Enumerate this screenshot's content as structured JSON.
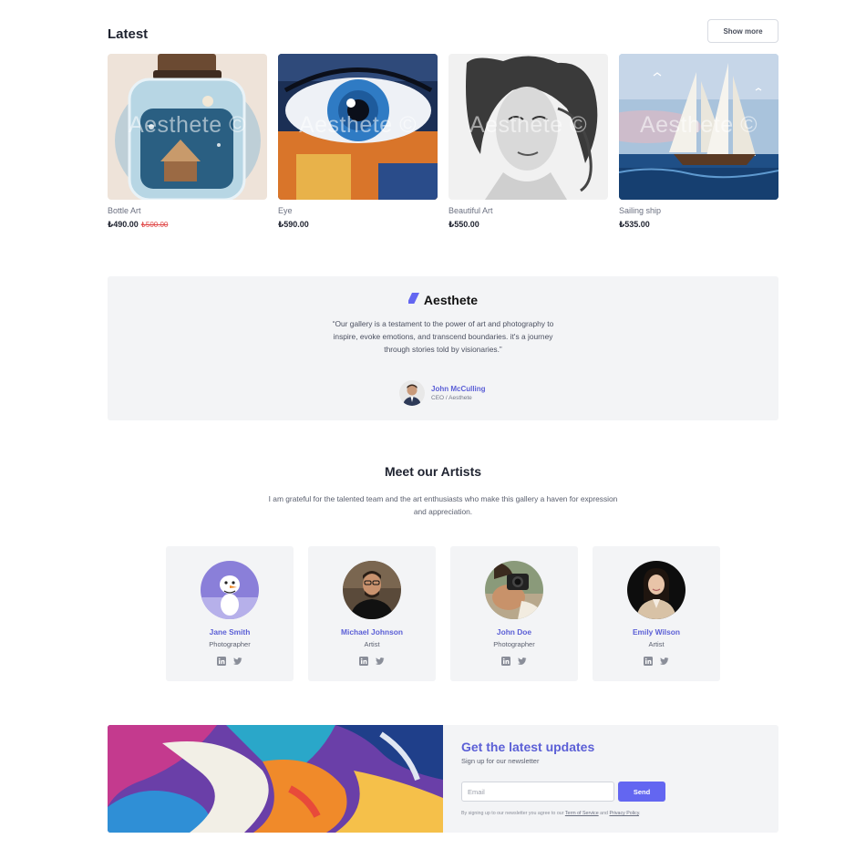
{
  "latest": {
    "heading": "Latest",
    "show_more": "Show more",
    "watermark": "Aesthete ©",
    "products": [
      {
        "name": "Bottle Art",
        "price": "₺490.00",
        "old_price": "₺500.00"
      },
      {
        "name": "Eye",
        "price": "₺590.00"
      },
      {
        "name": "Beautiful Art",
        "price": "₺550.00"
      },
      {
        "name": "Sailing ship",
        "price": "₺535.00"
      }
    ]
  },
  "testimonial": {
    "brand": "Aesthete",
    "quote": "“Our gallery is a testament to the power of art and photography to inspire, evoke emotions, and transcend boundaries. it's a journey through stories told by visionaries.”",
    "author_name": "John McCulling",
    "author_role": "CEO / Aesthete"
  },
  "artists": {
    "heading": "Meet our Artists",
    "subtitle": "I am grateful for the talented team and the art enthusiasts who make this gallery a haven for expression and appreciation.",
    "members": [
      {
        "name": "Jane Smith",
        "role": "Photographer"
      },
      {
        "name": "Michael Johnson",
        "role": "Artist"
      },
      {
        "name": "John Doe",
        "role": "Photographer"
      },
      {
        "name": "Emily Wilson",
        "role": "Artist"
      }
    ]
  },
  "newsletter": {
    "title": "Get the latest updates",
    "subtitle": "Sign up for our newsletter",
    "email_placeholder": "Email",
    "send_label": "Send",
    "legal_prefix": "By signing up to our newsletter you agree to our ",
    "terms": "Term of Service",
    "legal_and": " and ",
    "privacy": "Privacy Policy",
    "legal_suffix": "."
  },
  "colors": {
    "accent": "#6366f1",
    "accent_text": "#5b5fd6",
    "panel": "#f3f4f6",
    "sale": "#e04848"
  },
  "icons": [
    "brand-logo-icon",
    "linkedin-icon",
    "twitter-icon"
  ]
}
